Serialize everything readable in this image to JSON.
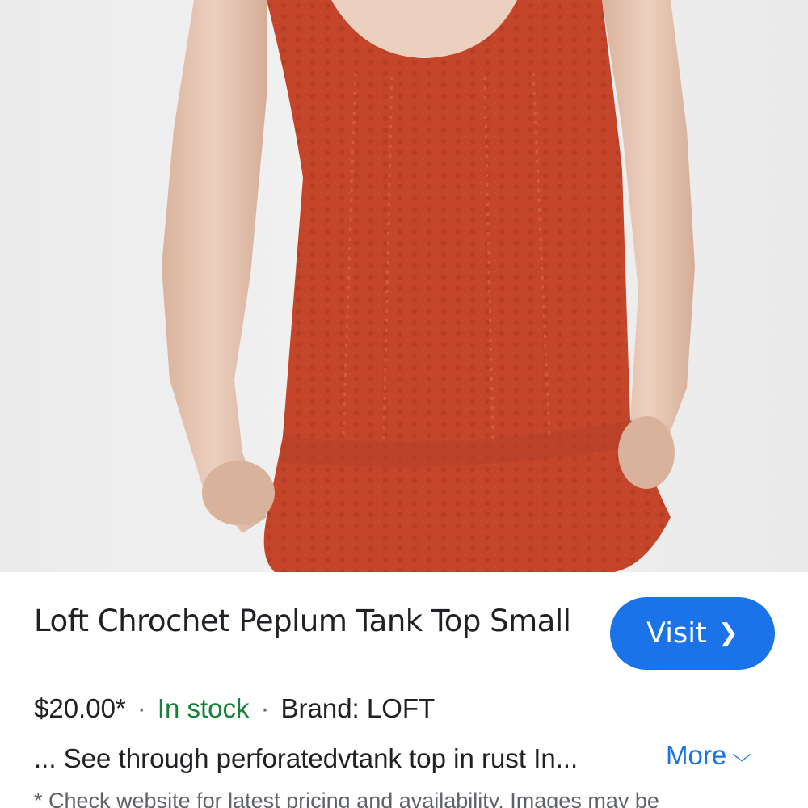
{
  "product": {
    "image_alt": "Rust crochet peplum tank top on model",
    "colors": {
      "garment": "#c4452a",
      "skin": "#e7c8b4",
      "background": "#eeeeee"
    }
  },
  "title": "Loft Chrochet Peplum Tank Top Small",
  "visit_button": {
    "label": "Visit",
    "icon": "chevron-right-icon",
    "color": "#1a73e8"
  },
  "meta": {
    "price": "$20.00*",
    "separator": "·",
    "stock": "In stock",
    "stock_color": "#188038",
    "brand": "Brand: LOFT"
  },
  "description": "... See through perforatedvtank top in rust In...",
  "more_button": {
    "label": "More",
    "icon": "chevron-down-icon"
  },
  "disclaimer": "* Check website for latest pricing and availability. Images may be"
}
